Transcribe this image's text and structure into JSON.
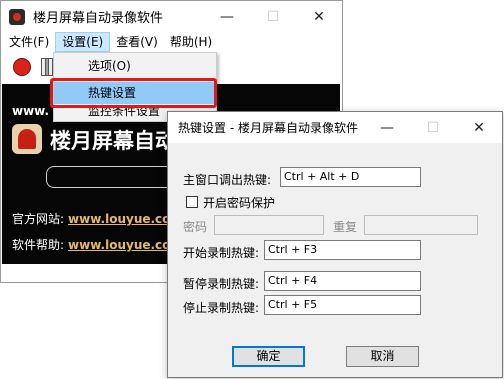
{
  "main_window": {
    "title": "楼月屏幕自动录像软件",
    "controls": {
      "minimize": "—",
      "maximize": "☐",
      "close": "✕"
    },
    "menu": [
      "文件(F)",
      "设置(E)",
      "查看(V)",
      "帮助(H)"
    ],
    "site_strip": "www.",
    "logo_text": "楼月屏幕自动",
    "info_rows": [
      {
        "label": "官方网站:",
        "link": "www.louyue.co"
      },
      {
        "label": "软件帮助:",
        "link": "www.louyue.co"
      }
    ]
  },
  "settings_menu": {
    "items": [
      "选项(O)",
      "热键设置",
      "监控条件设置"
    ],
    "highlighted": "热键设置"
  },
  "dialog": {
    "title": "热键设置 - 楼月屏幕自动录像软件",
    "controls": {
      "minimize": "—",
      "maximize": "☐",
      "close": "✕"
    },
    "main_hotkey_label": "主窗口调出热键:",
    "main_hotkey_value": "Ctrl + Alt + D",
    "password_checkbox_label": "开启密码保护",
    "password_checked": false,
    "password_label": "密码",
    "repeat_label": "重复",
    "start_label": "开始录制热键:",
    "start_value": "Ctrl + F3",
    "pause_label": "暂停录制热键:",
    "pause_value": "Ctrl + F4",
    "stop_label": "停止录制热键:",
    "stop_value": "Ctrl + F5",
    "ok_label": "确定",
    "cancel_label": "取消"
  },
  "colors": {
    "highlight": "#91c9f7",
    "annotation": "#e0191b",
    "link": "#e6b96a",
    "record": "#d8231b"
  }
}
